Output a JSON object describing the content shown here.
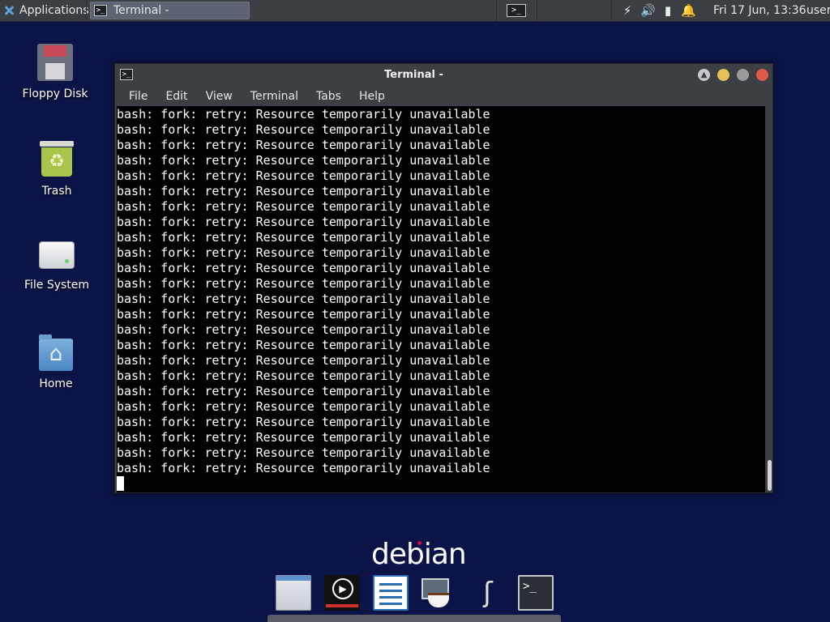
{
  "top_panel": {
    "applications_label": "Applications",
    "task_title": "Terminal -",
    "clock": "Fri 17 Jun, 13:36",
    "user": "user",
    "tray_icons": [
      "network-icon",
      "volume-icon",
      "battery-icon",
      "notification-bell-icon"
    ]
  },
  "desktop": {
    "icons": [
      {
        "label": "Floppy Disk",
        "icon": "floppy-disk-icon"
      },
      {
        "label": "Trash",
        "icon": "trash-icon"
      },
      {
        "label": "File System",
        "icon": "drive-icon"
      },
      {
        "label": "Home",
        "icon": "home-folder-icon"
      }
    ]
  },
  "window": {
    "title": "Terminal -",
    "menu": [
      "File",
      "Edit",
      "View",
      "Terminal",
      "Tabs",
      "Help"
    ],
    "terminal_lines": [
      "bash: fork: retry: Resource temporarily unavailable",
      "bash: fork: retry: Resource temporarily unavailable",
      "bash: fork: retry: Resource temporarily unavailable",
      "bash: fork: retry: Resource temporarily unavailable",
      "bash: fork: retry: Resource temporarily unavailable",
      "bash: fork: retry: Resource temporarily unavailable",
      "bash: fork: retry: Resource temporarily unavailable",
      "bash: fork: retry: Resource temporarily unavailable",
      "bash: fork: retry: Resource temporarily unavailable",
      "bash: fork: retry: Resource temporarily unavailable",
      "bash: fork: retry: Resource temporarily unavailable",
      "bash: fork: retry: Resource temporarily unavailable",
      "bash: fork: retry: Resource temporarily unavailable",
      "bash: fork: retry: Resource temporarily unavailable",
      "bash: fork: retry: Resource temporarily unavailable",
      "bash: fork: retry: Resource temporarily unavailable",
      "bash: fork: retry: Resource temporarily unavailable",
      "bash: fork: retry: Resource temporarily unavailable",
      "bash: fork: retry: Resource temporarily unavailable",
      "bash: fork: retry: Resource temporarily unavailable",
      "bash: fork: retry: Resource temporarily unavailable",
      "bash: fork: retry: Resource temporarily unavailable",
      "bash: fork: retry: Resource temporarily unavailable",
      "bash: fork: retry: Resource temporarily unavailable"
    ]
  },
  "branding": {
    "logo_text": "debian"
  },
  "dock": {
    "items": [
      "file-manager-icon",
      "media-player-icon",
      "writer-icon",
      "java-icon",
      "pin-icon",
      "terminal-icon"
    ]
  },
  "colors": {
    "desktop_background": "#0c1447",
    "panel_background": "#3b3e43",
    "terminal_background": "#000000",
    "terminal_foreground": "#ffffff",
    "close_button": "#e05a4a",
    "minimize_button": "#e6c15a"
  }
}
